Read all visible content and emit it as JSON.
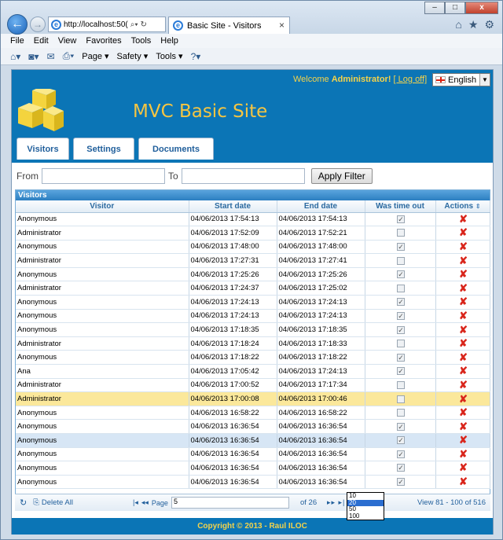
{
  "browser": {
    "address": "http://localhost:50(",
    "tab_title": "Basic Site - Visitors",
    "window_buttons": [
      "–",
      "□",
      "x"
    ],
    "menu": [
      "File",
      "Edit",
      "View",
      "Favorites",
      "Tools",
      "Help"
    ],
    "commands": [
      "Page ▾",
      "Safety ▾",
      "Tools ▾"
    ]
  },
  "header": {
    "welcome_prefix": "Welcome ",
    "user": "Administrator!",
    "logoff": "[ Log off]",
    "language": "English",
    "site_title": "MVC Basic Site",
    "tabs": [
      "Visitors",
      "Settings",
      "Documents"
    ]
  },
  "filter": {
    "from_label": "From",
    "to_label": "To",
    "from_value": "",
    "to_value": "",
    "apply_label": "Apply Filter"
  },
  "grid": {
    "caption": "Visitors",
    "columns": [
      "Visitor",
      "Start date",
      "End date",
      "Was time out",
      "Actions"
    ],
    "rows": [
      {
        "visitor": "Anonymous",
        "start": "04/06/2013 17:54:13",
        "end": "04/06/2013 17:54:13",
        "timeout": true
      },
      {
        "visitor": "Administrator",
        "start": "04/06/2013 17:52:09",
        "end": "04/06/2013 17:52:21",
        "timeout": false
      },
      {
        "visitor": "Anonymous",
        "start": "04/06/2013 17:48:00",
        "end": "04/06/2013 17:48:00",
        "timeout": true
      },
      {
        "visitor": "Administrator",
        "start": "04/06/2013 17:27:31",
        "end": "04/06/2013 17:27:41",
        "timeout": false
      },
      {
        "visitor": "Anonymous",
        "start": "04/06/2013 17:25:26",
        "end": "04/06/2013 17:25:26",
        "timeout": true
      },
      {
        "visitor": "Administrator",
        "start": "04/06/2013 17:24:37",
        "end": "04/06/2013 17:25:02",
        "timeout": false
      },
      {
        "visitor": "Anonymous",
        "start": "04/06/2013 17:24:13",
        "end": "04/06/2013 17:24:13",
        "timeout": true
      },
      {
        "visitor": "Anonymous",
        "start": "04/06/2013 17:24:13",
        "end": "04/06/2013 17:24:13",
        "timeout": true
      },
      {
        "visitor": "Anonymous",
        "start": "04/06/2013 17:18:35",
        "end": "04/06/2013 17:18:35",
        "timeout": true
      },
      {
        "visitor": "Administrator",
        "start": "04/06/2013 17:18:24",
        "end": "04/06/2013 17:18:33",
        "timeout": false
      },
      {
        "visitor": "Anonymous",
        "start": "04/06/2013 17:18:22",
        "end": "04/06/2013 17:18:22",
        "timeout": true
      },
      {
        "visitor": "Ana",
        "start": "04/06/2013 17:05:42",
        "end": "04/06/2013 17:24:13",
        "timeout": true
      },
      {
        "visitor": "Administrator",
        "start": "04/06/2013 17:00:52",
        "end": "04/06/2013 17:17:34",
        "timeout": false
      },
      {
        "visitor": "Administrator",
        "start": "04/06/2013 17:00:08",
        "end": "04/06/2013 17:00:46",
        "timeout": false
      },
      {
        "visitor": "Anonymous",
        "start": "04/06/2013 16:58:22",
        "end": "04/06/2013 16:58:22",
        "timeout": false
      },
      {
        "visitor": "Anonymous",
        "start": "04/06/2013 16:36:54",
        "end": "04/06/2013 16:36:54",
        "timeout": true
      },
      {
        "visitor": "Anonymous",
        "start": "04/06/2013 16:36:54",
        "end": "04/06/2013 16:36:54",
        "timeout": true
      },
      {
        "visitor": "Anonymous",
        "start": "04/06/2013 16:36:54",
        "end": "04/06/2013 16:36:54",
        "timeout": true
      },
      {
        "visitor": "Anonymous",
        "start": "04/06/2013 16:36:54",
        "end": "04/06/2013 16:36:54",
        "timeout": true
      },
      {
        "visitor": "Anonymous",
        "start": "04/06/2013 16:36:54",
        "end": "04/06/2013 16:36:54",
        "timeout": true
      }
    ],
    "selected_row": 13,
    "hover_row": 16
  },
  "pager": {
    "delete_all": "Delete All",
    "page_label": "Page",
    "page_value": "5",
    "of_label": "of 26",
    "view_text": "View 81 - 100 of 516",
    "page_sizes": [
      "10",
      "20",
      "50",
      "100"
    ],
    "selected_size": "20"
  },
  "footer": {
    "copyright": "Copyright © 2013 - Raul ILOC"
  },
  "colors": {
    "brand_blue": "#0b75b6",
    "accent_yellow": "#f5c542",
    "selected_row": "#fbe89b",
    "delete_red": "#d9261c"
  },
  "icons": [
    "back-arrow-icon",
    "forward-arrow-icon",
    "ie-icon",
    "search-icon",
    "refresh-icon",
    "close-icon",
    "home-icon",
    "star-icon",
    "gear-icon",
    "rss-icon",
    "mail-icon",
    "print-icon",
    "help-icon",
    "logo-cubes-icon",
    "flag-icon",
    "delete-icon",
    "checkbox-icon",
    "sort-icon"
  ]
}
